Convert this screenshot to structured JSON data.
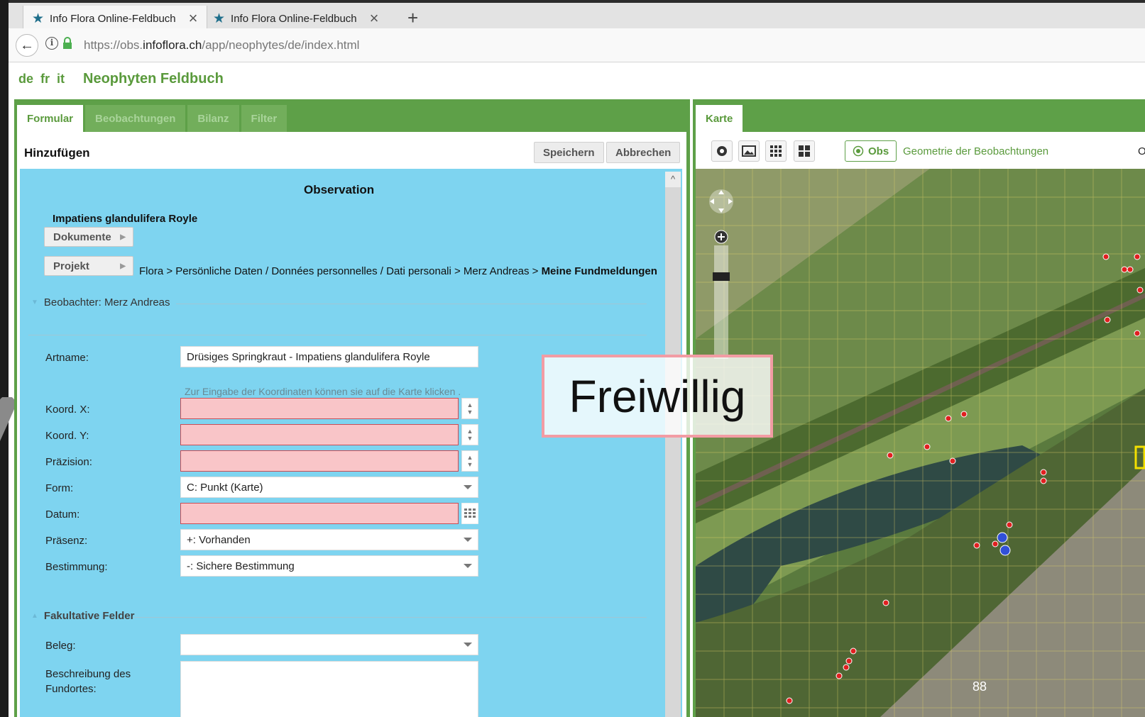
{
  "browser": {
    "tabs": [
      {
        "title": "Info Flora Online-Feldbuch"
      },
      {
        "title": "Info Flora Online-Feldbuch"
      }
    ],
    "url_prefix": "https://obs.",
    "url_domain": "infoflora.ch",
    "url_path": "/app/neophytes/de/index.html"
  },
  "app": {
    "languages": [
      "de",
      "fr",
      "it"
    ],
    "title": "Neophyten Feldbuch"
  },
  "left_panel": {
    "tabs": [
      "Formular",
      "Beobachtungen",
      "Bilanz",
      "Filter"
    ],
    "heading": "Hinzufügen",
    "save_label": "Speichern",
    "cancel_label": "Abbrechen"
  },
  "form": {
    "title": "Observation",
    "species": "Impatiens glandulifera Royle",
    "documents_label": "Dokumente",
    "project_label": "Projekt",
    "breadcrumb_prefix": "Flora > Persönliche Daten / Données personnelles / Dati personali > Merz Andreas > ",
    "breadcrumb_last": "Meine Fundmeldungen",
    "observer_section": "Beobachter: Merz Andreas",
    "coord_hint": "Zur Eingabe der Koordinaten können sie auf die Karte klicken .",
    "fields": {
      "artname_label": "Artname:",
      "artname_value": "Drüsiges Springkraut - Impatiens glandulifera Royle",
      "koord_x_label": "Koord. X:",
      "koord_x_value": "",
      "koord_y_label": "Koord. Y:",
      "koord_y_value": "",
      "praezision_label": "Präzision:",
      "praezision_value": "",
      "form_label": "Form:",
      "form_value": "C: Punkt (Karte)",
      "datum_label": "Datum:",
      "datum_value": "",
      "praesenz_label": "Präsenz:",
      "praesenz_value": "+: Vorhanden",
      "bestimmung_label": "Bestimmung:",
      "bestimmung_value": "-: Sichere Bestimmung"
    },
    "optional_section": "Fakultative Felder",
    "beleg_label": "Beleg:",
    "beleg_value": "",
    "description_label_1": "Beschreibung des",
    "description_label_2": "Fundortes:"
  },
  "map_panel": {
    "tab": "Karte",
    "obs_label": "Obs",
    "geometry_label": "Geometrie der Beobachtungen",
    "cut_label": "O"
  },
  "overlay": {
    "callout": "Freiwillig",
    "page_number": "88"
  },
  "colors": {
    "brand_green": "#5ea048",
    "form_bg": "#7ed4f0",
    "error_field": "#f9c5c8",
    "callout_border": "#f29ca4"
  }
}
